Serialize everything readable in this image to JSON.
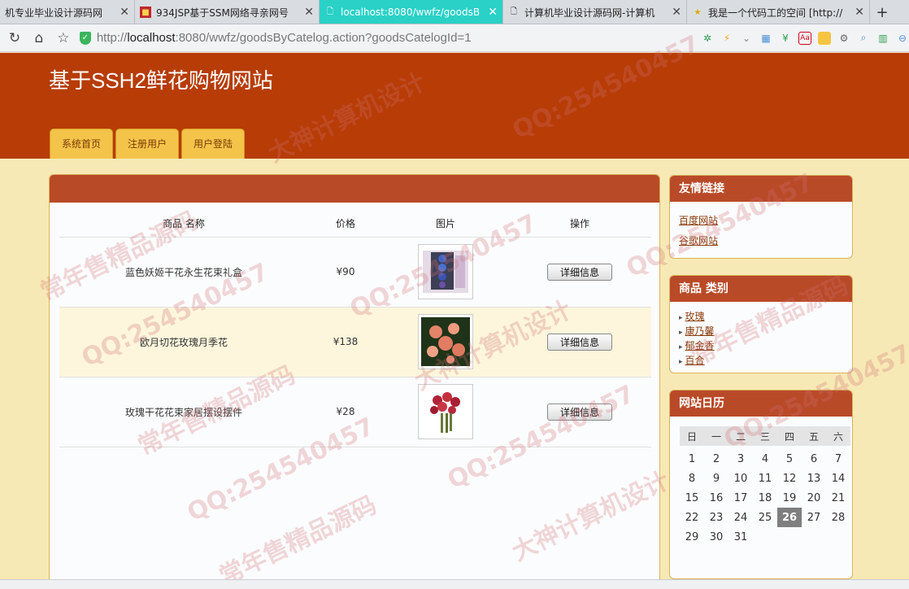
{
  "browser": {
    "tabs": [
      {
        "title": "机专业毕业设计源码网",
        "favicon": "none",
        "active": false
      },
      {
        "title": "934JSP基于SSM网络寻亲网号",
        "favicon": "red-square-icon",
        "active": false
      },
      {
        "title": "localhost:8080/wwfz/goodsB",
        "favicon": "page-icon",
        "active": true
      },
      {
        "title": "计算机毕业设计源码网-计算机",
        "favicon": "page-icon",
        "active": false
      },
      {
        "title": "我是一个代码工的空间 [http://",
        "favicon": "star-icon",
        "active": false
      }
    ],
    "new_tab": "+",
    "url_prefix": "http://",
    "url_host": "localhost",
    "url_rest": ":8080/wwfz/goodsByCatelog.action?goodsCatelogId=1"
  },
  "site": {
    "title": "基于SSH2鲜花购物网站",
    "menu": [
      "系统首页",
      "注册用户",
      "用户登陆"
    ]
  },
  "products": {
    "headers": [
      "商品 名称",
      "价格",
      "图片",
      "操作"
    ],
    "rows": [
      {
        "name": "蓝色妖姬干花永生花束礼盒",
        "price": "¥90",
        "action": "详细信息"
      },
      {
        "name": "欧月切花玫瑰月季花",
        "price": "¥138",
        "action": "详细信息"
      },
      {
        "name": "玫瑰干花花束家居摆设摆件",
        "price": "¥28",
        "action": "详细信息"
      }
    ]
  },
  "sidebar": {
    "links_title": "友情链接",
    "links": [
      "百度网站",
      "谷歌网站"
    ],
    "categories_title": "商品 类别",
    "categories": [
      "玫瑰",
      "康乃馨",
      "郁金香",
      "百合"
    ],
    "calendar_title": "网站日历",
    "weekdays": [
      "日",
      "一",
      "二",
      "三",
      "四",
      "五",
      "六"
    ],
    "weeks": [
      [
        "1",
        "2",
        "3",
        "4",
        "5",
        "6",
        "7"
      ],
      [
        "8",
        "9",
        "10",
        "11",
        "12",
        "13",
        "14"
      ],
      [
        "15",
        "16",
        "17",
        "18",
        "19",
        "20",
        "21"
      ],
      [
        "22",
        "23",
        "24",
        "25",
        "26",
        "27",
        "28"
      ],
      [
        "29",
        "30",
        "31",
        "",
        "",
        "",
        ""
      ]
    ],
    "today": "26"
  },
  "watermarks": [
    "常年售精品源码",
    "QQ:254540457",
    "大神计算机设计"
  ]
}
